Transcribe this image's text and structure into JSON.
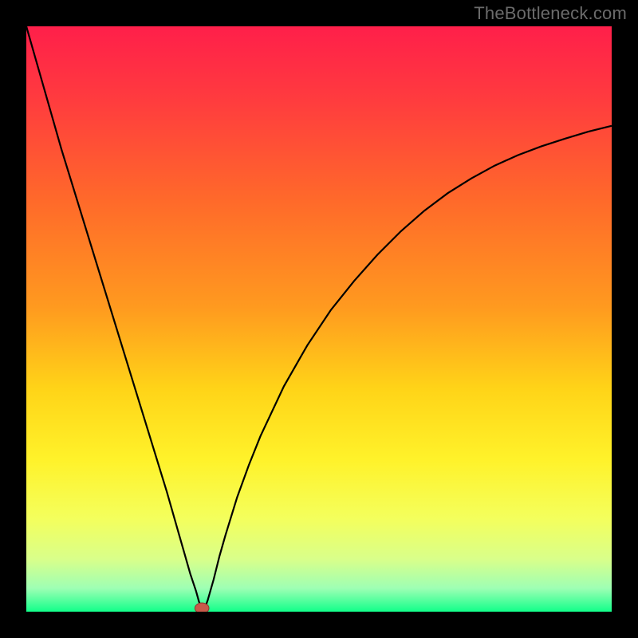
{
  "attribution": "TheBottleneck.com",
  "colors": {
    "frame": "#000000",
    "curve": "#000000",
    "marker_fill": "#c85a4a",
    "marker_stroke": "#8f3a30",
    "gradient_stops": [
      {
        "offset": 0.0,
        "color": "#ff1f4a"
      },
      {
        "offset": 0.12,
        "color": "#ff3a3f"
      },
      {
        "offset": 0.3,
        "color": "#ff6a2a"
      },
      {
        "offset": 0.48,
        "color": "#ff9a1f"
      },
      {
        "offset": 0.62,
        "color": "#ffd418"
      },
      {
        "offset": 0.74,
        "color": "#fff22a"
      },
      {
        "offset": 0.84,
        "color": "#f4ff5c"
      },
      {
        "offset": 0.91,
        "color": "#d9ff8a"
      },
      {
        "offset": 0.96,
        "color": "#9effb4"
      },
      {
        "offset": 1.0,
        "color": "#12ff8a"
      }
    ]
  },
  "chart_data": {
    "type": "line",
    "title": "",
    "xlabel": "",
    "ylabel": "",
    "xlim": [
      0,
      100
    ],
    "ylim": [
      0,
      100
    ],
    "grid": false,
    "legend": false,
    "optimum_x": 30,
    "series": [
      {
        "name": "bottleneck-curve",
        "x": [
          0,
          2,
          4,
          6,
          8,
          10,
          12,
          14,
          16,
          18,
          20,
          22,
          24,
          26,
          27,
          28,
          29,
          29.5,
          30,
          30.5,
          31,
          32,
          33,
          34,
          36,
          38,
          40,
          44,
          48,
          52,
          56,
          60,
          64,
          68,
          72,
          76,
          80,
          84,
          88,
          92,
          96,
          100
        ],
        "y": [
          100,
          93,
          86,
          79,
          72.5,
          66,
          59.5,
          53,
          46.5,
          40,
          33.5,
          27,
          20.5,
          13.5,
          10,
          6.5,
          3.5,
          1.7,
          0.6,
          0.6,
          2.0,
          5.5,
          9.5,
          13.0,
          19.5,
          25.0,
          30.0,
          38.5,
          45.5,
          51.5,
          56.5,
          61.0,
          65.0,
          68.5,
          71.5,
          74.0,
          76.2,
          78.0,
          79.5,
          80.8,
          82.0,
          83.0
        ]
      }
    ],
    "marker": {
      "x": 30,
      "y": 0.6,
      "rx": 1.2,
      "ry": 0.9
    }
  }
}
